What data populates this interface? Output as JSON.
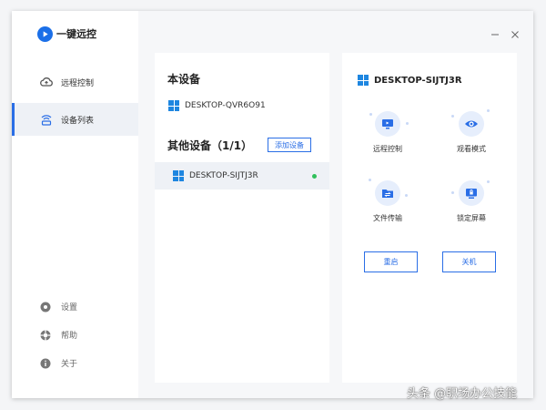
{
  "app": {
    "title": "一键远控"
  },
  "sidebar": {
    "items": [
      {
        "label": "远程控制",
        "icon": "cloud-icon"
      },
      {
        "label": "设备列表",
        "icon": "device-list-icon"
      }
    ],
    "footer": [
      {
        "label": "设置",
        "icon": "gear-icon"
      },
      {
        "label": "帮助",
        "icon": "help-icon"
      },
      {
        "label": "关于",
        "icon": "info-icon"
      }
    ]
  },
  "window_controls": {
    "minimize": "—",
    "close": "✕"
  },
  "device_list": {
    "this_device_title": "本设备",
    "this_device_name": "DESKTOP-QVR6O91",
    "other_devices_title": "其他设备（1/1）",
    "add_device_label": "添加设备",
    "other_devices": [
      {
        "name": "DESKTOP-SIJTJ3R",
        "status": "online",
        "status_color": "#2fc05b"
      }
    ]
  },
  "detail": {
    "device_name": "DESKTOP-SIJTJ3R",
    "actions": [
      {
        "label": "远程控制",
        "icon": "remote-desktop-icon"
      },
      {
        "label": "观看模式",
        "icon": "eye-icon"
      },
      {
        "label": "文件传输",
        "icon": "folder-transfer-icon"
      },
      {
        "label": "锁定屏幕",
        "icon": "lock-screen-icon"
      }
    ],
    "restart_label": "重启",
    "shutdown_label": "关机"
  },
  "watermark": "头条 @职场办公技能",
  "colors": {
    "accent": "#2a6ee6",
    "windows_blue": "#1e86e0",
    "online": "#2fc05b"
  }
}
